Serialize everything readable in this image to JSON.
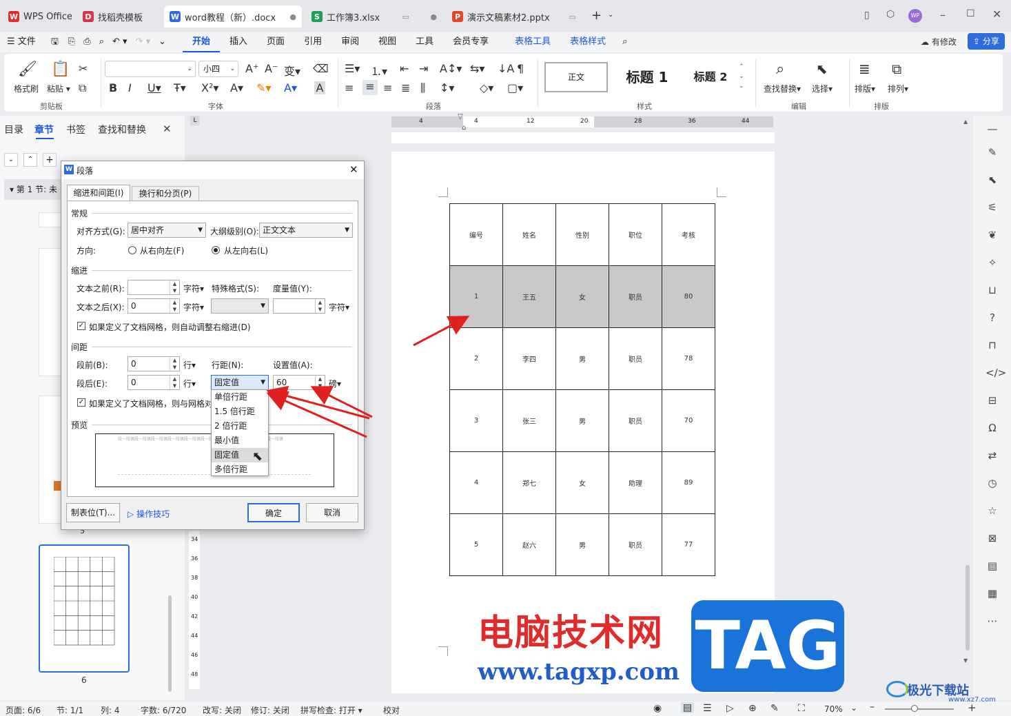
{
  "tabs": [
    {
      "label": "WPS Office",
      "icon": "wps-logo-icon"
    },
    {
      "label": "找稻壳模板",
      "icon": "docer-icon"
    },
    {
      "label": "word教程（新）.docx",
      "icon": "word-doc-icon",
      "marker": "●"
    },
    {
      "label": "工作簿3.xlsx",
      "icon": "sheet-icon",
      "marker": "●"
    },
    {
      "label": "演示文稿素材2.pptx",
      "icon": "ppt-icon"
    }
  ],
  "window": {
    "modified_label": "有修改",
    "share_label": "分享",
    "avatar_text": "WP"
  },
  "menu": {
    "file": "文件",
    "items": [
      "开始",
      "插入",
      "页面",
      "引用",
      "审阅",
      "视图",
      "工具",
      "会员专享"
    ],
    "context_items": [
      "表格工具",
      "表格样式"
    ]
  },
  "ribbon": {
    "format_painter": "格式刷",
    "paste": "粘贴",
    "font_size": "小四",
    "styles": [
      "正文",
      "标题 1",
      "标题 2"
    ],
    "find_replace": "查找替换",
    "select": "选择",
    "arrange": "排版",
    "sort": "排列",
    "groups": [
      "剪贴板",
      "字体",
      "段落",
      "样式",
      "编辑",
      "排版"
    ]
  },
  "nav": {
    "tabs": [
      "目录",
      "章节",
      "书签",
      "查找和替换"
    ],
    "section_label": "第 1 节: 未",
    "page_labels": [
      "5",
      "6"
    ]
  },
  "ruler": {
    "labels": [
      "4",
      "4",
      "12",
      "20",
      "28",
      "36",
      "44"
    ],
    "vlabels": [
      "34",
      "36",
      "38",
      "40",
      "42",
      "44",
      "46",
      "48"
    ]
  },
  "table": {
    "header": [
      "编号",
      "姓名",
      "性别",
      "职位",
      "考核"
    ],
    "rows": [
      [
        "1",
        "王五",
        "女",
        "职员",
        "80"
      ],
      [
        "2",
        "李四",
        "男",
        "职员",
        "78"
      ],
      [
        "3",
        "张三",
        "男",
        "职员",
        "70"
      ],
      [
        "4",
        "郑七",
        "女",
        "助理",
        "89"
      ],
      [
        "5",
        "赵六",
        "男",
        "职员",
        "77"
      ]
    ]
  },
  "dialog": {
    "title": "段落",
    "tabs": [
      "缩进和间距(I)",
      "换行和分页(P)"
    ],
    "general": "常规",
    "align_label": "对齐方式(G):",
    "align_value": "居中对齐",
    "outline_label": "大纲级别(O):",
    "outline_value": "正文文本",
    "direction_label": "方向:",
    "rtl_label": "从右向左(F)",
    "ltr_label": "从左向右(L)",
    "indent": "缩进",
    "before_text_label": "文本之前(R):",
    "before_text_value": "",
    "after_text_label": "文本之后(X):",
    "after_text_value": "0",
    "char_unit": "字符▾",
    "special_label": "特殊格式(S):",
    "measure_label": "度量值(Y):",
    "auto_indent_label": "如果定义了文档网格，则自动调整右缩进(D)",
    "spacing": "间距",
    "before_label": "段前(B):",
    "before_value": "0",
    "after_label": "段后(E):",
    "after_value": "0",
    "line_unit": "行▾",
    "line_spacing_label": "行距(N):",
    "line_spacing_value": "固定值",
    "set_value_label": "设置值(A):",
    "set_value": "60",
    "pound_unit": "磅▾",
    "grid_align_label": "如果定义了文档网格，则与网格对",
    "preview": "预览",
    "preview_text": "段一段落段一段落段一段落段一段落段一段落段一段落段一段落段一段落段一段落段一段落",
    "tab_stops_button": "制表位(T)...",
    "tips_link": "操作技巧",
    "ok_button": "确定",
    "cancel_button": "取消",
    "line_spacing_options": [
      "单倍行距",
      "1.5 倍行距",
      "2 倍行距",
      "最小值",
      "固定值",
      "多倍行距"
    ],
    "hovered_option": "固定值"
  },
  "status": {
    "page": "页面: 6/6",
    "section": "节: 1/1",
    "column": "列: 4",
    "words": "字数: 6/720",
    "revise": "改写: 关闭",
    "track": "修订: 关闭",
    "spell": "拼写检查: 打开 ▾",
    "proof": "校对",
    "zoom": "70%"
  },
  "watermark": {
    "cn": "电脑技术网",
    "url": "www.tagxp.com",
    "tag": "TAG",
    "corner": "极光下载站",
    "corner_url": "www.xz7.com"
  },
  "colors": {
    "accent": "#1a56db",
    "arrow": "#e02020",
    "highlight_row": "#c8c8c8",
    "tag_blue": "#1a73d9"
  }
}
